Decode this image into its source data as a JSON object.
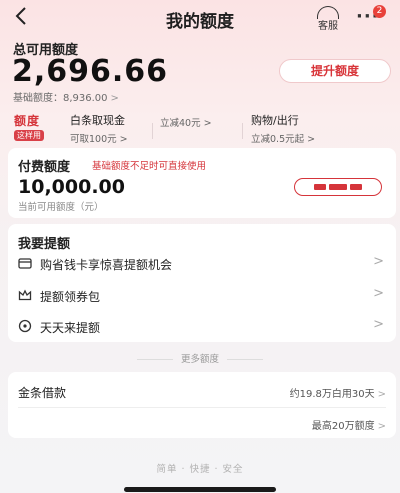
{
  "header": {
    "title": "我的额度",
    "service_label": "客服",
    "more_label": "···",
    "badge_count": "2"
  },
  "total": {
    "label": "总可用额度",
    "amount": "2,696.66",
    "base_text": "基础额度：8,936.00",
    "chevron": ">",
    "raise_button": "提升额度"
  },
  "tabs": {
    "active_label": "额度",
    "active_pill": "这样用",
    "items": [
      {
        "title": "白条取现金",
        "sub": "可取100元 >"
      },
      {
        "title": "",
        "sub": "立减40元 >"
      },
      {
        "title": "购物/出行",
        "sub": "立减0.5元起 >"
      }
    ]
  },
  "paid": {
    "title": "付费额度",
    "note": "基础额度不足时可直接使用",
    "amount": "10,000.00",
    "sub": "当前可用额度（元）"
  },
  "boost": {
    "title": "我要提额",
    "items": [
      {
        "label": "购省钱卡享惊喜提额机会",
        "arrow": ">"
      },
      {
        "label": "提额领券包",
        "arrow": ">"
      },
      {
        "label": "天天来提额",
        "arrow": ">"
      }
    ]
  },
  "more_divider": "更多额度",
  "loan": {
    "title": "金条借款",
    "right1": "约19.8万白用30天",
    "right2": "最高20万额度",
    "arrow": ">"
  },
  "footer": "简单 · 快捷 · 安全",
  "colors": {
    "accent": "#d5343a",
    "bg_top": "#fbe3e4",
    "card": "#ffffff"
  }
}
